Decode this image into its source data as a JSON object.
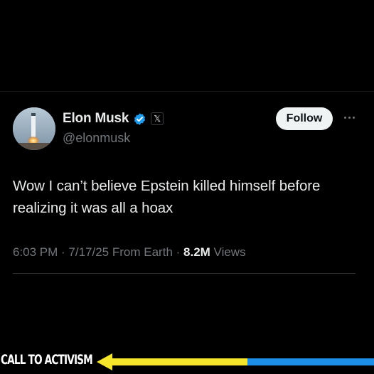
{
  "tweet": {
    "author": {
      "display_name": "Elon Musk",
      "handle": "@elonmusk",
      "verified": true,
      "avatar_icon": "rocket-launch-avatar",
      "affiliation_badge": "𝕏"
    },
    "follow_label": "Follow",
    "text": "Wow I can’t believe Epstein killed himself before realizing it was all a hoax",
    "meta": {
      "time": "6:03 PM",
      "sep1": " · ",
      "date": "7/17/25",
      "source": " From Earth",
      "sep2": " · ",
      "views_count": "8.2M",
      "views_label": " Views"
    }
  },
  "banner": {
    "text": "CALL TO ACTIVISM",
    "arrow_colors": {
      "yellow": "#f5e62c",
      "blue": "#1d8fe8"
    }
  },
  "colors": {
    "background": "#000000",
    "primary_text": "#e7e9ea",
    "secondary_text": "#71767b",
    "verified_blue": "#1d9bf0",
    "follow_bg": "#eff3f4"
  }
}
